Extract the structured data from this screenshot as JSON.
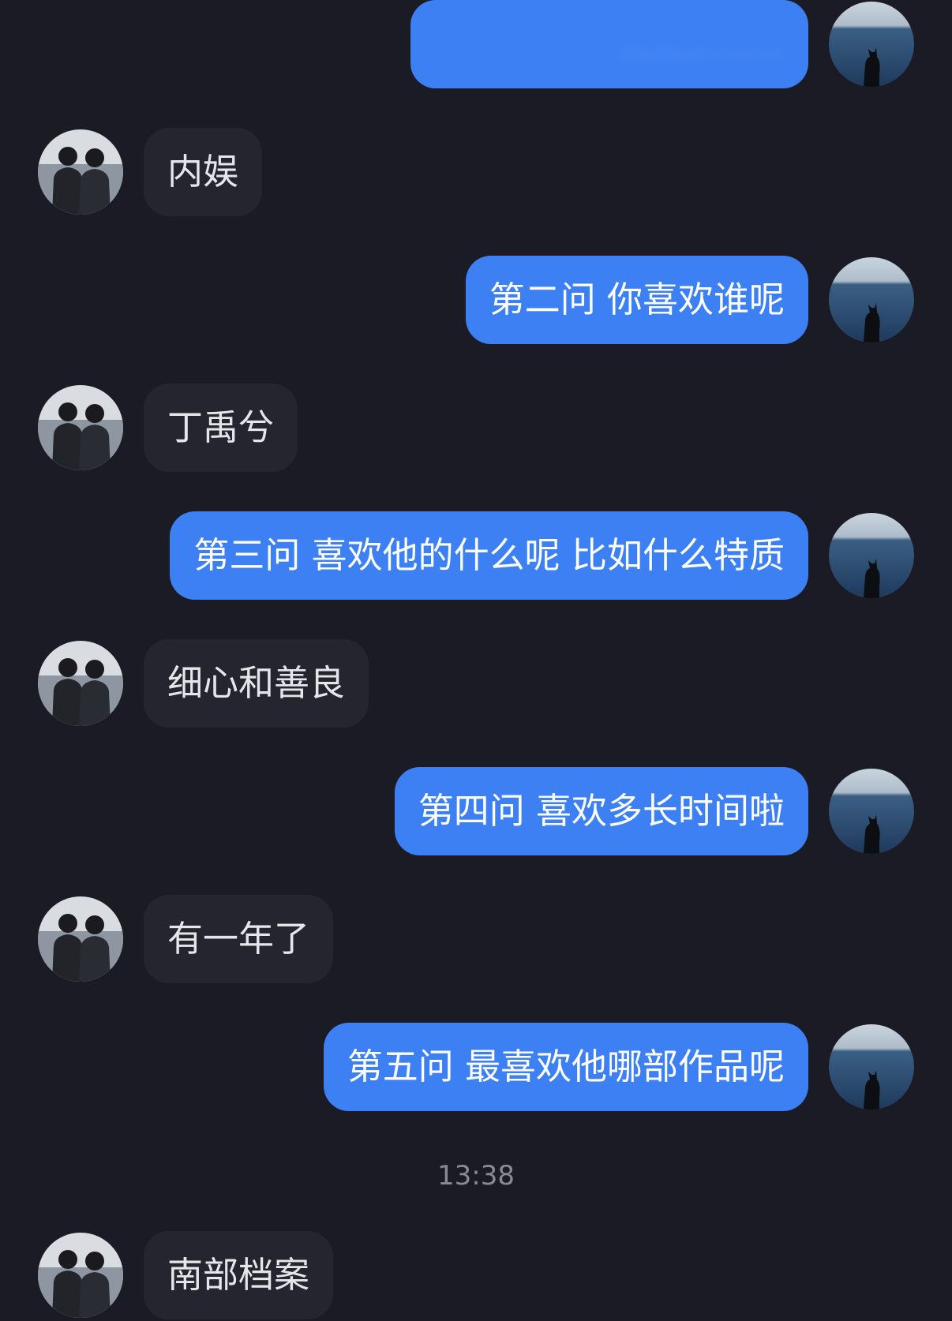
{
  "chat": {
    "messages": [
      {
        "from": "self",
        "text": "……………",
        "blurred": true
      },
      {
        "from": "peer",
        "text": "内娱"
      },
      {
        "from": "self",
        "text": "第二问 你喜欢谁呢"
      },
      {
        "from": "peer",
        "text": "丁禹兮"
      },
      {
        "from": "self",
        "text": "第三问 喜欢他的什么呢 比如什么特质"
      },
      {
        "from": "peer",
        "text": "细心和善良"
      },
      {
        "from": "self",
        "text": "第四问 喜欢多长时间啦"
      },
      {
        "from": "peer",
        "text": "有一年了"
      },
      {
        "from": "self",
        "text": "第五问 最喜欢他哪部作品呢"
      },
      {
        "from": "peer",
        "text": "南部档案"
      }
    ],
    "timestamp": "13:38"
  },
  "avatars": {
    "self": "sea-cat-avatar",
    "peer": "two-people-avatar"
  },
  "colors": {
    "background": "#1b1b25",
    "self_bubble": "#3d80f3",
    "peer_bubble": "#252530",
    "timestamp": "#8a8a95"
  }
}
